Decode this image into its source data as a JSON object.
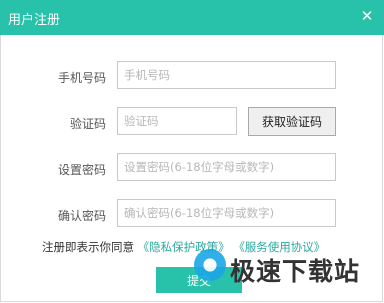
{
  "window": {
    "title": "用户注册",
    "close_symbol": "✕"
  },
  "form": {
    "phone": {
      "label": "手机号码",
      "placeholder": "手机号码",
      "value": ""
    },
    "code": {
      "label": "验证码",
      "placeholder": "验证码",
      "value": "",
      "button": "获取验证码"
    },
    "password": {
      "label": "设置密码",
      "placeholder": "设置密码(6-18位字母或数字)",
      "value": ""
    },
    "confirm": {
      "label": "确认密码",
      "placeholder": "确认密码(6-18位字母或数字)",
      "value": ""
    }
  },
  "agreement": {
    "text": "注册即表示你同意",
    "privacy_link": "《隐私保护政策》",
    "service_link": "《服务使用协议》"
  },
  "submit_label": "提交",
  "watermark": {
    "text": "极速下载站",
    "icon": "download-site-logo-icon"
  },
  "colors": {
    "accent": "#28c2ab",
    "link": "#2aa9a0"
  }
}
